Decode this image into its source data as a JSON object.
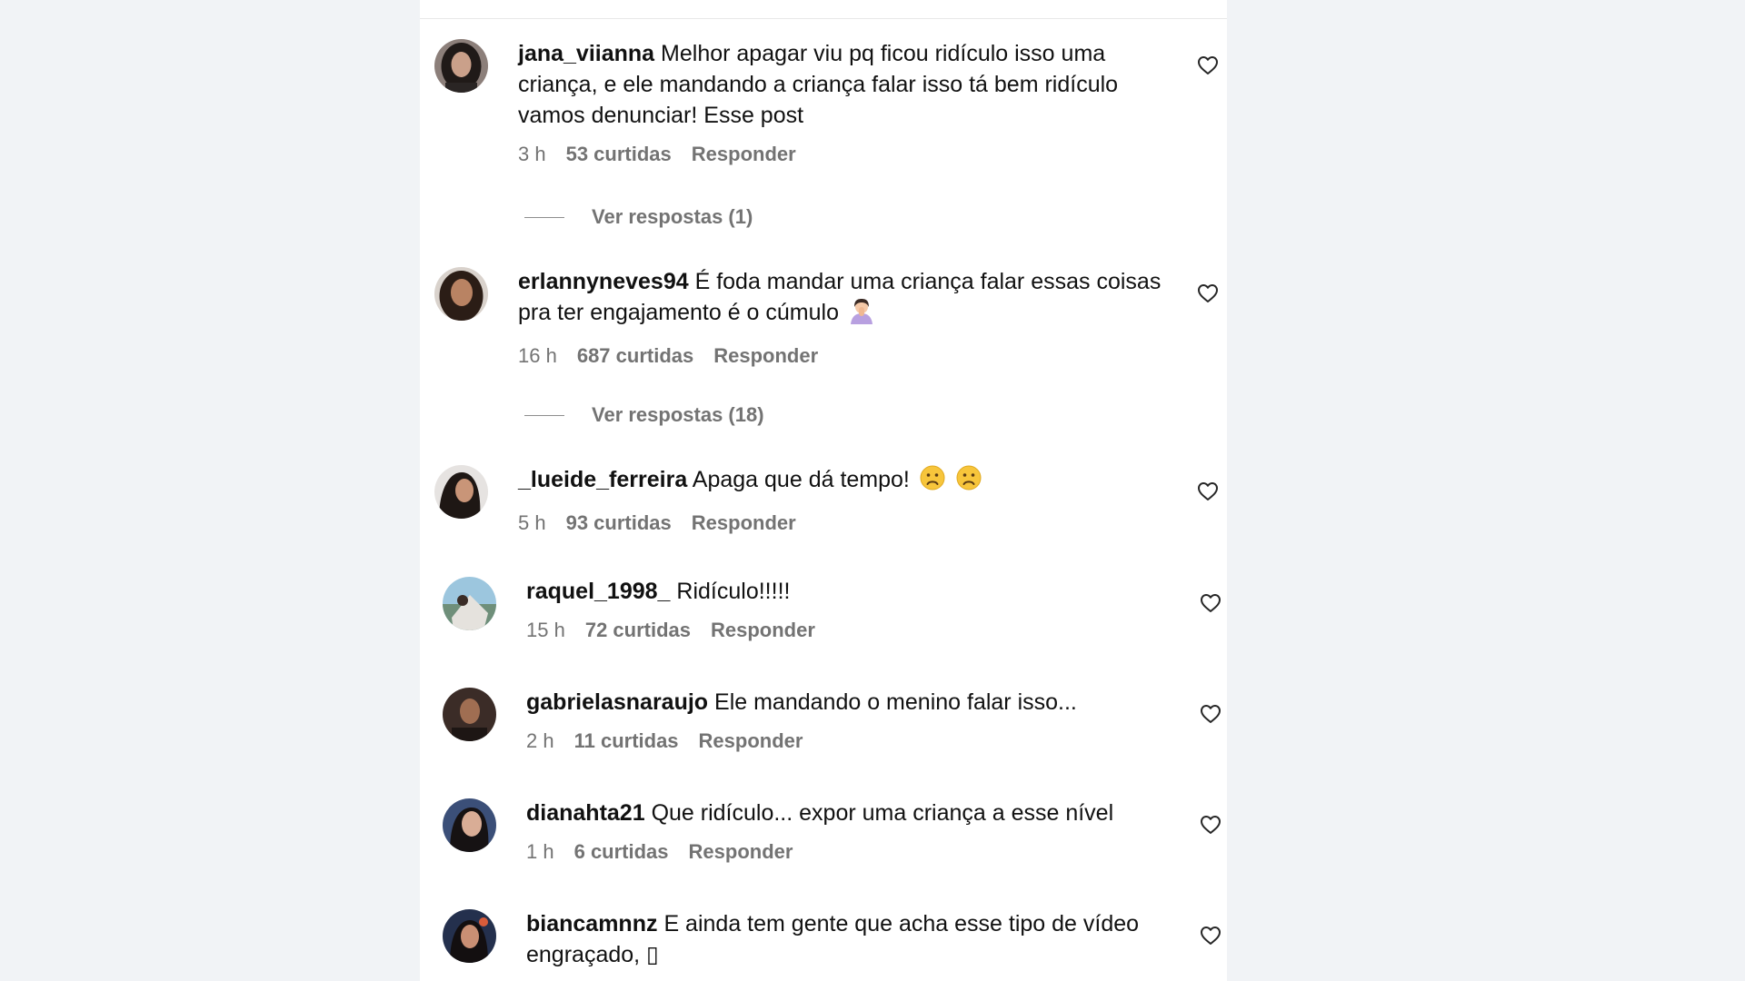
{
  "comments": [
    {
      "username": "jana_viianna",
      "text": "Melhor apagar viu pq ficou ridículo isso uma criança, e ele mandando a criança falar isso tá bem ridículo vamos denunciar! Esse post",
      "time": "3 h",
      "likes": "53 curtidas",
      "reply": "Responder",
      "view_replies": "Ver respostas (1)"
    },
    {
      "username": "erlannyneves94",
      "text": "É foda mandar uma criança falar essas coisas pra ter engajamento é o cúmulo",
      "emoji": "woman-facepalming",
      "time": "16 h",
      "likes": "687 curtidas",
      "reply": "Responder",
      "view_replies": "Ver respostas (18)"
    },
    {
      "username": "_lueide_ferreira",
      "text": "Apaga que dá tempo!",
      "emoji": "sad-face x2",
      "time": "5 h",
      "likes": "93 curtidas",
      "reply": "Responder"
    },
    {
      "username": "raquel_1998_",
      "text": "Ridículo!!!!!",
      "time": "15 h",
      "likes": "72 curtidas",
      "reply": "Responder"
    },
    {
      "username": "gabrielasnaraujo",
      "text": "Ele mandando o menino falar isso...",
      "time": "2 h",
      "likes": "11 curtidas",
      "reply": "Responder"
    },
    {
      "username": "dianahta21",
      "text": "Que ridículo... expor uma criança a esse nível",
      "time": "1 h",
      "likes": "6 curtidas",
      "reply": "Responder"
    },
    {
      "username": "biancamnnz",
      "text": "E ainda tem gente que acha esse tipo de vídeo engraçado, ▯",
      "time": "",
      "likes": "",
      "reply": ""
    }
  ],
  "colors": {
    "page_background": "#f1f3f6",
    "panel_background": "#ffffff",
    "text_primary": "#111111",
    "text_secondary": "#737373"
  },
  "icons": {
    "like": "heart-icon",
    "reply_line": "reply-line"
  }
}
